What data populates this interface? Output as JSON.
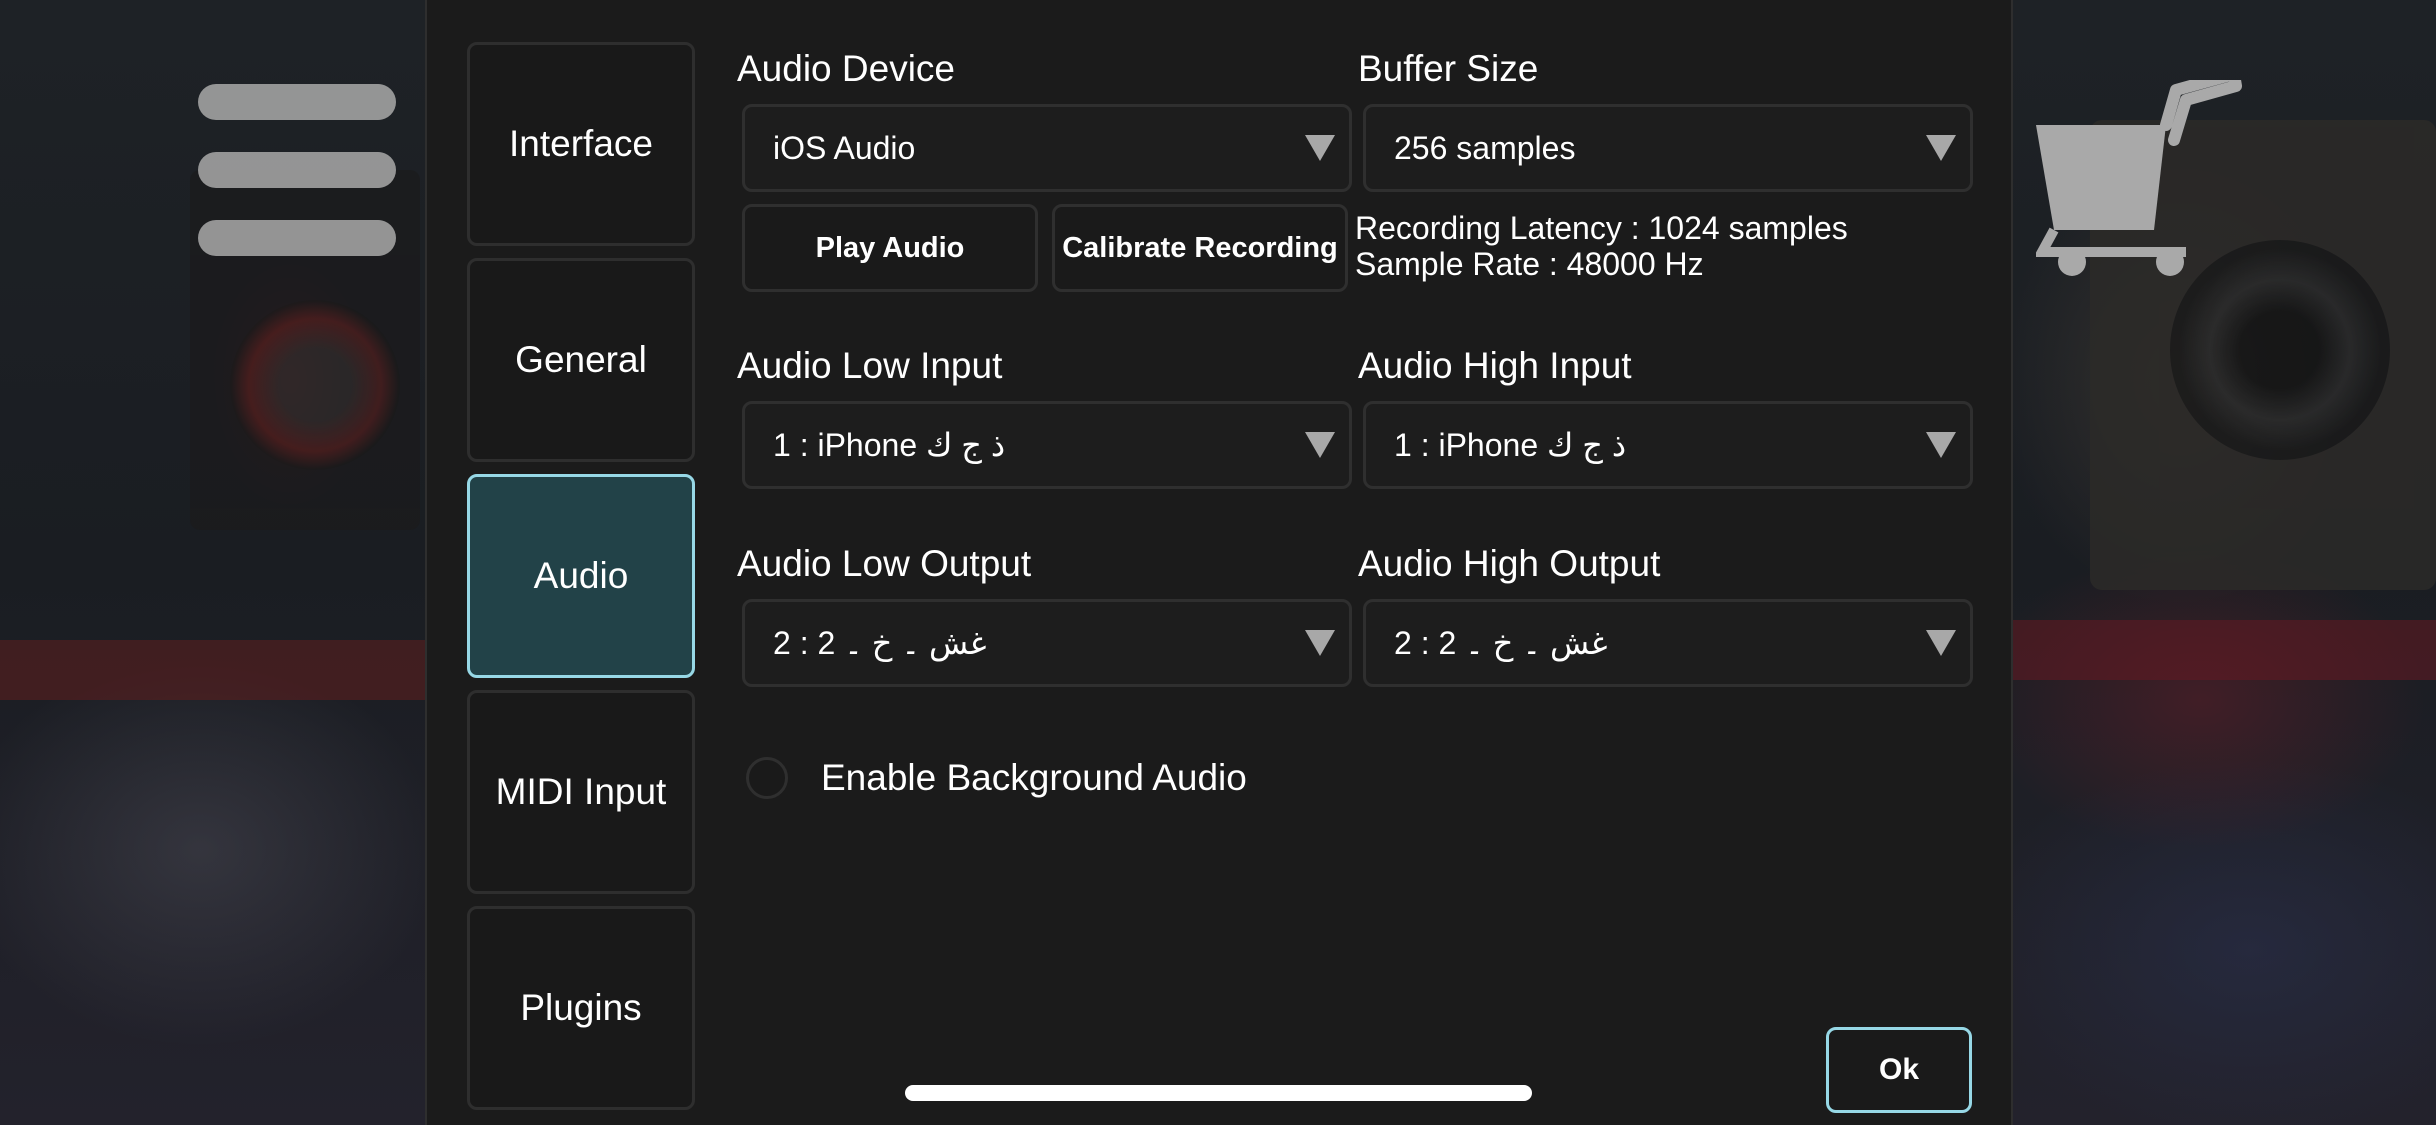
{
  "menu": {
    "icon": "hamburger-menu-icon"
  },
  "store": {
    "icon": "shopping-cart-icon"
  },
  "tabs": [
    {
      "label": "Interface",
      "active": false
    },
    {
      "label": "General",
      "active": false
    },
    {
      "label": "Audio",
      "active": true
    },
    {
      "label": "MIDI Input",
      "active": false
    },
    {
      "label": "Plugins",
      "active": false
    }
  ],
  "audio_device": {
    "label": "Audio Device",
    "value": "iOS Audio"
  },
  "buffer_size": {
    "label": "Buffer Size",
    "value": "256 samples"
  },
  "actions": {
    "play_audio": "Play Audio",
    "calibrate_recording": "Calibrate Recording"
  },
  "info": {
    "recording_latency": "Recording Latency : 1024 samples",
    "sample_rate": "Sample Rate : 48000 Hz"
  },
  "audio_low_input": {
    "label": "Audio Low Input",
    "value": "1 : iPhone ذ ج ك"
  },
  "audio_high_input": {
    "label": "Audio High Input",
    "value": "1 : iPhone ذ ج ك"
  },
  "audio_low_output": {
    "label": "Audio Low Output",
    "value": "2 : غش ۔ خ ۔ 2"
  },
  "audio_high_output": {
    "label": "Audio High Output",
    "value": "2 : غش ۔ خ ۔ 2"
  },
  "background_audio": {
    "label": "Enable Background Audio",
    "checked": false
  },
  "ok_button": "Ok",
  "colors": {
    "accent": "#97d8e6",
    "active_tab_bg": "#224248",
    "panel_bg": "#1b1b1b",
    "control_border": "#2f2f2f"
  }
}
